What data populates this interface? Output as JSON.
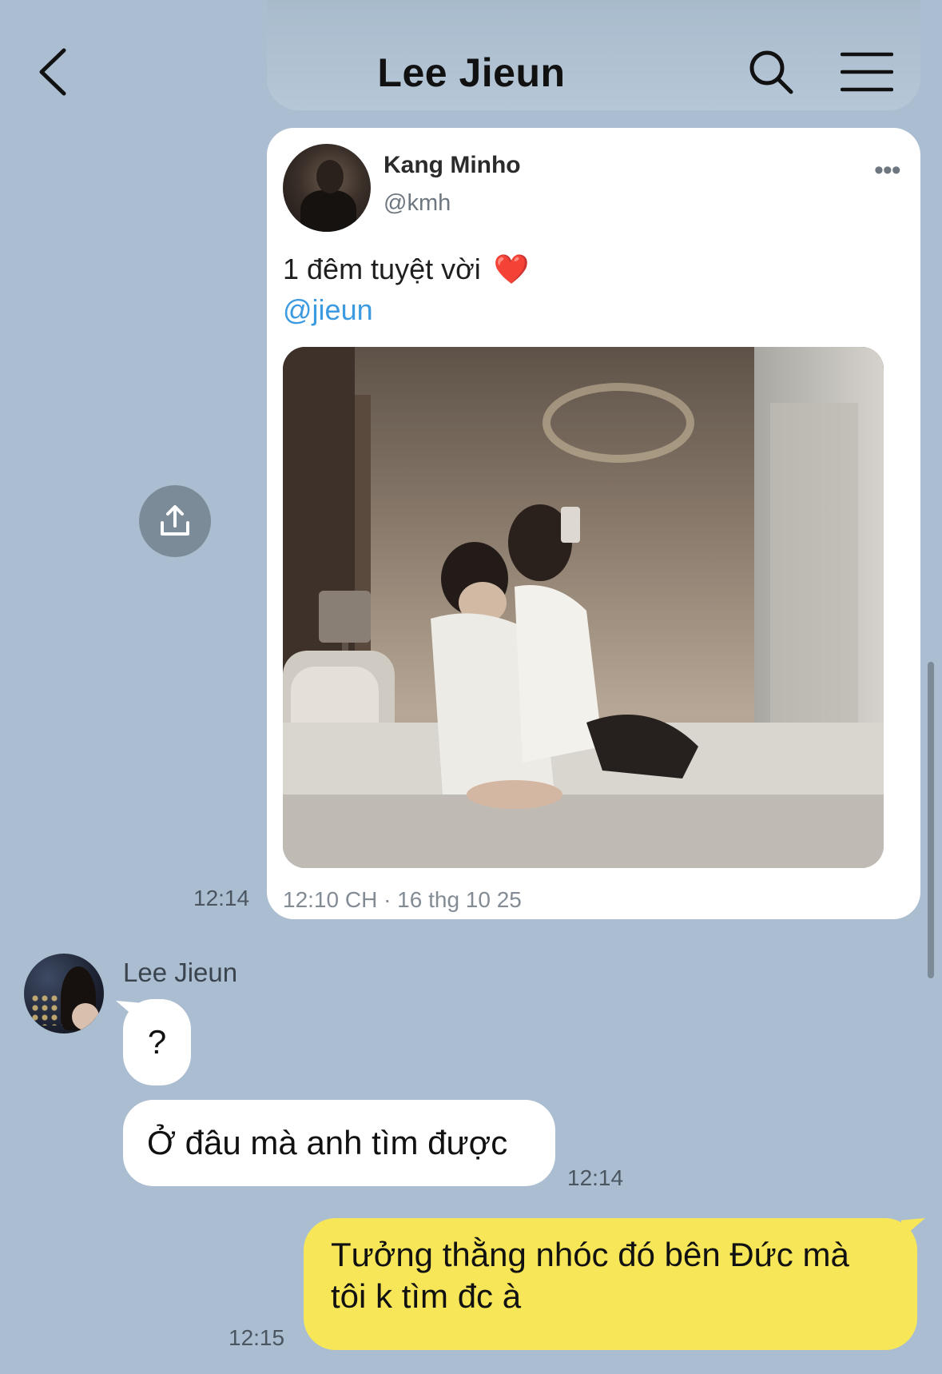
{
  "header": {
    "title": "Lee Jieun",
    "back_icon": "chevron-left-icon",
    "search_icon": "search-icon",
    "menu_icon": "hamburger-menu-icon"
  },
  "share": {
    "icon": "share-upload-icon"
  },
  "tweet": {
    "author_name": "Kang Minho",
    "author_handle": "@kmh",
    "more": "•••",
    "text": "1 đêm tuyệt vời",
    "text_emoji": "❤️",
    "mention": "@jieun",
    "timestamp": "12:10 CH · 16 thg 10 25",
    "sent_time": "12:14"
  },
  "incoming": {
    "sender_name": "Lee Jieun",
    "messages": [
      {
        "text": "?"
      },
      {
        "text": "Ở đâu mà anh tìm được",
        "time": "12:14"
      }
    ]
  },
  "outgoing": {
    "message_line1": "Tưởng thằng nhóc đó bên Đức mà",
    "message_line2": "tôi k tìm đc à",
    "time": "12:15"
  },
  "colors": {
    "background": "#abbed1",
    "outgoing_bubble": "#f7e758",
    "incoming_bubble": "#ffffff",
    "mention": "#3b9ae0",
    "heart": "#e63946"
  }
}
